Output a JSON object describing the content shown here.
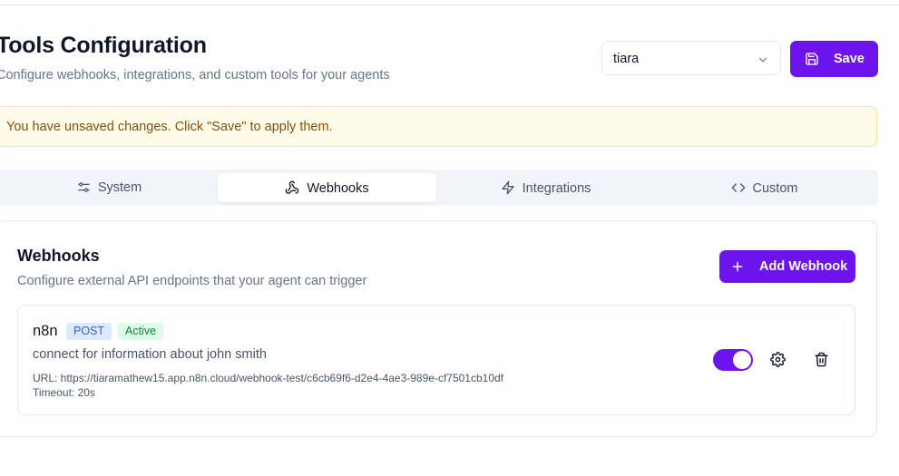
{
  "header": {
    "title": "Tools Configuration",
    "subtitle": "Configure webhooks, integrations, and custom tools for your agents"
  },
  "agent_select": {
    "value": "tiara",
    "icon": "chevron-down-icon"
  },
  "save_button": {
    "label": "Save",
    "icon": "save-icon"
  },
  "banner": {
    "text": "You have unsaved changes. Click \"Save\" to apply them."
  },
  "tabs": [
    {
      "label": "System",
      "icon": "sliders-icon",
      "active": false
    },
    {
      "label": "Webhooks",
      "icon": "webhook-icon",
      "active": true
    },
    {
      "label": "Integrations",
      "icon": "lightning-icon",
      "active": false
    },
    {
      "label": "Custom",
      "icon": "code-icon",
      "active": false
    }
  ],
  "webhooks_card": {
    "title": "Webhooks",
    "description": "Configure external API endpoints that your agent can trigger",
    "add_button": "Add Webhook",
    "items": [
      {
        "name": "n8n",
        "method": "POST",
        "status": "Active",
        "description": "connect for information about john smith",
        "url": "URL: https://tiaramathew15.app.n8n.cloud/webhook-test/c6cb69f6-d2e4-4ae3-989e-cf7501cb10df",
        "timeout": "Timeout: 20s",
        "enabled": true
      }
    ]
  },
  "colors": {
    "accent": "#6d14ee",
    "banner_bg": "#fefce8",
    "banner_text": "#854d0e",
    "method_badge_bg": "#dbeafe",
    "status_badge_bg": "#dcfce7"
  }
}
